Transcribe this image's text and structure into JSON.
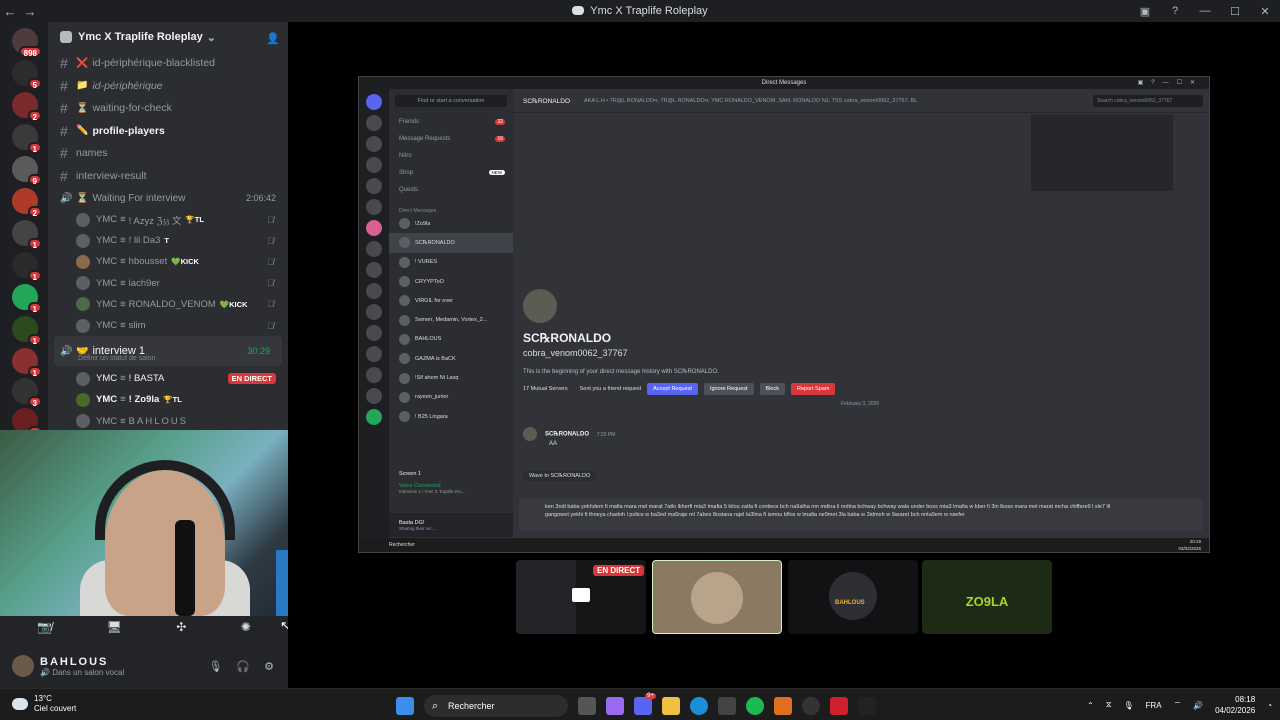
{
  "window": {
    "title": "Ymc X Traplife Roleplay"
  },
  "rail": {
    "servers": [
      {
        "badge": "898"
      },
      {
        "badge": "5"
      },
      {
        "badge": "2"
      },
      {
        "badge": "1"
      },
      {
        "badge": "9"
      },
      {
        "badge": "2"
      },
      {
        "badge": "1"
      },
      {
        "badge": "1"
      },
      {
        "badge": "1"
      },
      {
        "badge": "1"
      },
      {
        "badge": "1"
      },
      {
        "badge": "3"
      },
      {
        "badge": "1"
      }
    ]
  },
  "server": {
    "name": "Ymc X Traplife Roleplay"
  },
  "channels": [
    {
      "label": "id-périphérique-blacklisted",
      "emoji": "❌"
    },
    {
      "label": "id-périphérique",
      "emoji": "📁"
    },
    {
      "label": "waiting-for-check",
      "emoji": "⏳"
    },
    {
      "label": "profile-players",
      "emoji": "✏️"
    },
    {
      "label": "names",
      "emoji": ""
    },
    {
      "label": "interview-result",
      "emoji": ""
    }
  ],
  "voice_waiting": {
    "label": "Waiting For interview",
    "time": "2:06:42",
    "members": [
      {
        "prefix": "YMC",
        "name": "! Azyz ℨ𝔷𝔷 文",
        "tag": "🏆TL"
      },
      {
        "prefix": "YMC",
        "name": "! lil Da3",
        "tag": "T"
      },
      {
        "prefix": "YMC",
        "name": "hbousset",
        "tag": "KICK"
      },
      {
        "prefix": "YMC",
        "name": "lach9er",
        "tag": ""
      },
      {
        "prefix": "YMC",
        "name": "RONALDO_VENOM",
        "tag": "KICK"
      },
      {
        "prefix": "YMC",
        "name": "slim",
        "tag": ""
      }
    ]
  },
  "voice_interview": {
    "label": "interview 1",
    "time": "30:29",
    "status_hint": "Définir un statut de salon",
    "members": [
      {
        "prefix": "YMC",
        "name": "! BASTA",
        "live": "EN DIRECT"
      },
      {
        "prefix": "YMC",
        "name": "! Zo9la",
        "tag": "🏆TL"
      },
      {
        "prefix": "YMC",
        "name": "BAHLOUS"
      }
    ]
  },
  "user": {
    "name": "BAHLOUS",
    "status": "Dans un salon vocal"
  },
  "stream": {
    "window_title": "Direct Messages",
    "find": "Find or start a conversation",
    "nav": [
      {
        "label": "Friends",
        "count": "22"
      },
      {
        "label": "Message Requests",
        "count": "16"
      },
      {
        "label": "Nitro",
        "count": ""
      },
      {
        "label": "Shop",
        "count": "NEW"
      },
      {
        "label": "Quests",
        "count": ""
      }
    ],
    "dm_header": "Direct Messages",
    "dms": [
      "!Zo9la",
      "SC℞RONALDO",
      "! VURES",
      "CRYYPToO",
      "VIRGIL for ever",
      "Svmerr, Medamin, Vortex_2...",
      "BAHLOUS",
      "GAZMA is BaCK",
      "!Sif ahem Ni Lasq",
      "rayeen_junior",
      "! B25 Lingara"
    ],
    "voice_connected": "Voice Connected",
    "voice_sub": "Interview 1 / Ymc X Traplife Ro...",
    "screen_label": "Screen 1",
    "self": "Basta DG!",
    "self_status": "Sharing their scr...",
    "header_name": "SC℞RONALDO",
    "header_aka": "AKA  L.H • 7R@L  RONALDO•r, 7R@L  RONALDO•r, YMC  RONALDO_VENOM, SA#L  RONALDO NJ, TSS cobra_venom0062_37767, BL",
    "search": "Search cobra_venom0062_37767",
    "profile_name": "SC℞RONALDO",
    "profile_user": "cobra_venom0062_37767",
    "beginning": "This is the beginning of your direct message history with SC℞RONALDO.",
    "mutual": "17 Mutual Servers",
    "sent": "Sent you a friend request",
    "accept": "Accept Request",
    "ignore": "Ignore Request",
    "block": "Block",
    "spam": "Report Spam",
    "date": "February 3, 2026",
    "msg_author": "SC℞RONALDO",
    "msg_time": "7:23 PM",
    "msg_body": "AA",
    "wave": "Wave to SC℞RONALDO",
    "draft": "ken 3ndi baba yekhdem fi mafia mara mel marat 7atlo lkherfi mta3 lmafia 5 kilou zatla fi contiera bch na9alha mn mdina li mdina bchway bchway wala under boss mta3 lmafia w kber fi 3in lboss mara mel marat mcha chiffare9 l sle7 lil gangowet yekhi fi thneya chadoh l police w ba3ed ma5raje ml 7abes 8ostana rajel la3lina fi ismou bflos w lmafia ne9met 3la baba w 3idmoh w 9araret bch nnta9em w nsefer",
    "taskbar_search": "Rechercher",
    "clock_time": "20:19",
    "clock_date": "03/02/2026"
  },
  "tiles": {
    "live": "EN DIRECT",
    "tile3_label": "BAHLOUS",
    "tile4_label": "ZO9LA"
  },
  "taskbar": {
    "weather_temp": "13°C",
    "weather_desc": "Ciel couvert",
    "search": "Rechercher",
    "lang": "FRA",
    "time": "08:18",
    "date": "04/02/2026",
    "discord_badge": "9+"
  }
}
